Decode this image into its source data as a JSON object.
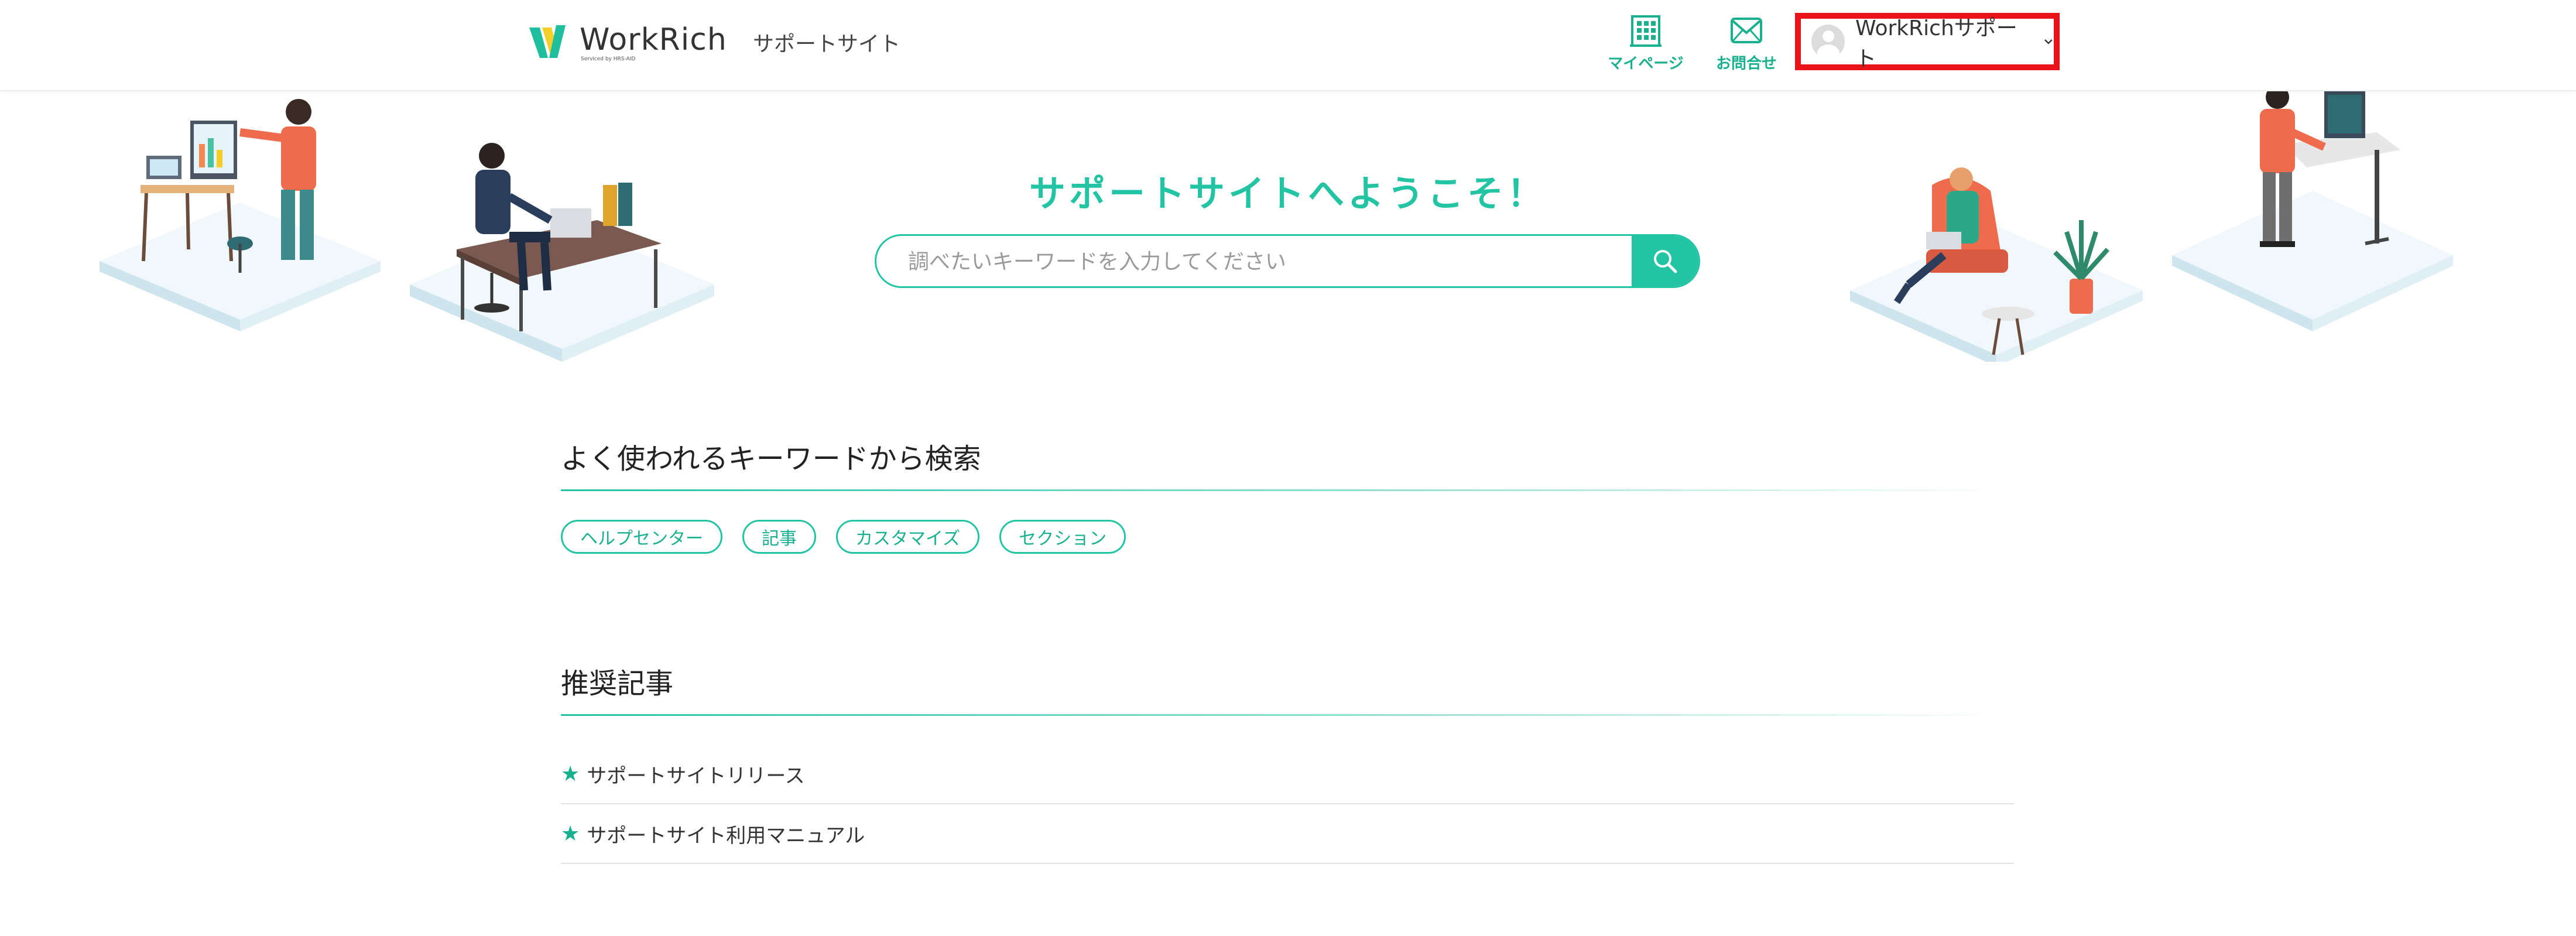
{
  "header": {
    "logo_text": "WorkRich",
    "logo_sub": "Serviced by HRS-AID",
    "site_label": "サポートサイト",
    "nav": {
      "mypage_label": "マイページ",
      "contact_label": "お問合せ"
    },
    "user_name": "WorkRichサポート"
  },
  "hero": {
    "title": "サポートサイトへようこそ！",
    "search_placeholder": "調べたいキーワードを入力してください"
  },
  "keywords": {
    "title": "よく使われるキーワードから検索",
    "tags": [
      "ヘルプセンター",
      "記事",
      "カスタマイズ",
      "セクション"
    ]
  },
  "recommended": {
    "title": "推奨記事",
    "articles": [
      "サポートサイトリリース",
      "サポートサイト利用マニュアル"
    ]
  },
  "colors": {
    "accent": "#22c4a3",
    "accent_dark": "#19b08f",
    "highlight_box": "#e8141a"
  }
}
